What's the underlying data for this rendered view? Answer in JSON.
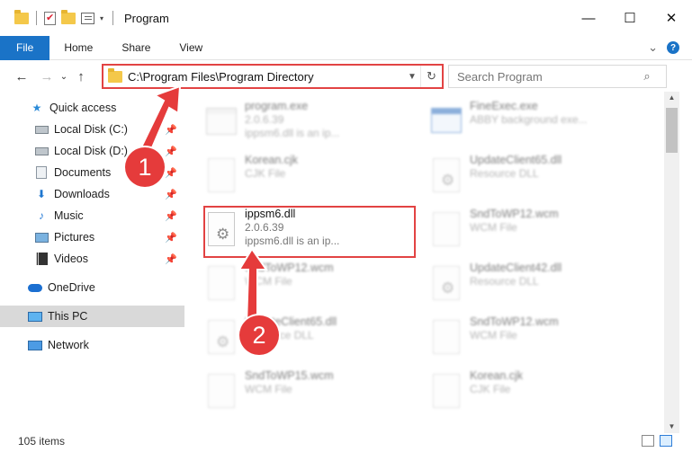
{
  "window": {
    "title": "Program",
    "minimize_glyph": "—",
    "maximize_glyph": "☐",
    "close_glyph": "✕"
  },
  "ribbon": {
    "tabs": [
      "File",
      "Home",
      "Share",
      "View"
    ],
    "expand_glyph": "⌄",
    "help_glyph": "?"
  },
  "nav": {
    "back_glyph": "←",
    "forward_glyph": "→",
    "recent_glyph": "⌄",
    "up_glyph": "↑",
    "address": "C:\\Program Files\\Program Directory",
    "search_placeholder": "Search Program",
    "search_icon": "⌕",
    "refresh_glyph": "↻"
  },
  "sidebar": {
    "quick_access": "Quick access",
    "items": [
      {
        "label": "Local Disk (C:)"
      },
      {
        "label": "Local Disk (D:)"
      },
      {
        "label": "Documents"
      },
      {
        "label": "Downloads"
      },
      {
        "label": "Music"
      },
      {
        "label": "Pictures"
      },
      {
        "label": "Videos"
      }
    ],
    "onedrive": "OneDrive",
    "this_pc": "This PC",
    "network": "Network"
  },
  "files": {
    "col1": [
      {
        "name": "program.exe",
        "line2": "2.0.6.39",
        "line3": "ippsm6.dll is an ip..."
      },
      {
        "name": "Korean.cjk",
        "line2": "CJK File",
        "line3": ""
      },
      {
        "name": "ippsm6.dll",
        "line2": "2.0.6.39",
        "line3": "ippsm6.dll is an ip..."
      },
      {
        "name": "SndToWP12.wcm",
        "line2": "WCM File",
        "line3": ""
      },
      {
        "name": "UpdateClient65.dll",
        "line2": "Resource DLL",
        "line3": ""
      },
      {
        "name": "SndToWP15.wcm",
        "line2": "WCM File",
        "line3": ""
      }
    ],
    "col2": [
      {
        "name": "FineExec.exe",
        "line2": "ABBY background exe...",
        "line3": ""
      },
      {
        "name": "UpdateClient65.dll",
        "line2": "Resource DLL",
        "line3": ""
      },
      {
        "name": "SndToWP12.wcm",
        "line2": "WCM File",
        "line3": ""
      },
      {
        "name": "UpdateClient42.dll",
        "line2": "Resource DLL",
        "line3": ""
      },
      {
        "name": "SndToWP12.wcm",
        "line2": "WCM File",
        "line3": ""
      },
      {
        "name": "Korean.cjk",
        "line2": "CJK File",
        "line3": ""
      }
    ]
  },
  "annotations": {
    "step1": "1",
    "step2": "2",
    "color": "#e24343"
  },
  "status": {
    "count": "105 items"
  },
  "icons": {
    "pin": "✦"
  }
}
